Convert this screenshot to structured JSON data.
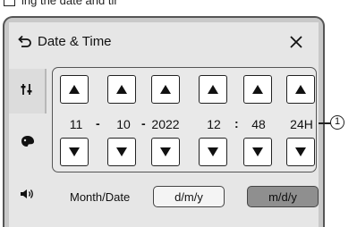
{
  "window": {
    "title": "Date & Time",
    "back_icon": "back-arrow-icon",
    "close_icon": "close-icon"
  },
  "top_fragment": {
    "text": "ing the date and time"
  },
  "sidebar": {
    "items": [
      {
        "icon": "sliders-icon",
        "selected": true
      },
      {
        "icon": "palette-icon",
        "selected": false
      },
      {
        "icon": "speaker-icon",
        "selected": false
      }
    ]
  },
  "datetime": {
    "month": "11",
    "day": "10",
    "year": "2022",
    "hour": "12",
    "minute": "48",
    "format": "24H",
    "date_separator": "-",
    "time_separator": ":"
  },
  "month_date": {
    "label": "Month/Date",
    "options": [
      "d/m/y",
      "m/d/y"
    ],
    "selected": "m/d/y"
  },
  "callout": {
    "label": "1"
  },
  "colors": {
    "screen_bg": "#e6e6e6",
    "button_bg": "#ffffff",
    "selected_option_bg": "#8f8f8f",
    "bezel": "#c9c9c9"
  }
}
